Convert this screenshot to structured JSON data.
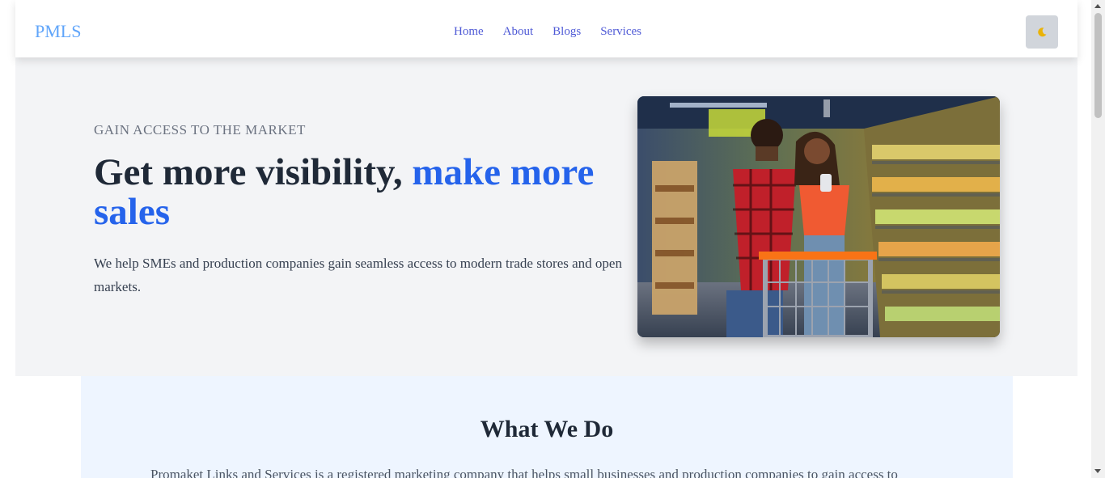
{
  "nav": {
    "brand": "PMLS",
    "links": [
      "Home",
      "About",
      "Blogs",
      "Services"
    ],
    "theme_toggle_icon": "moon-icon"
  },
  "hero": {
    "eyebrow": "GAIN ACCESS TO THE MARKET",
    "title_main": "Get more visibility,",
    "title_accent": "make more sales",
    "description": "We help SMEs and production companies gain seamless access to modern trade stores and open markets.",
    "image_icon": "supermarket-shoppers-photo"
  },
  "what_we_do": {
    "title": "What We Do",
    "text": "Promaket Links and Services is a registered marketing company that helps small businesses and production companies to gain access to"
  },
  "colors": {
    "brand": "#60a5fa",
    "nav_link": "#4f5ad6",
    "accent": "#2563eb",
    "hero_bg": "#f3f4f6",
    "section_bg": "#eef5ff"
  }
}
